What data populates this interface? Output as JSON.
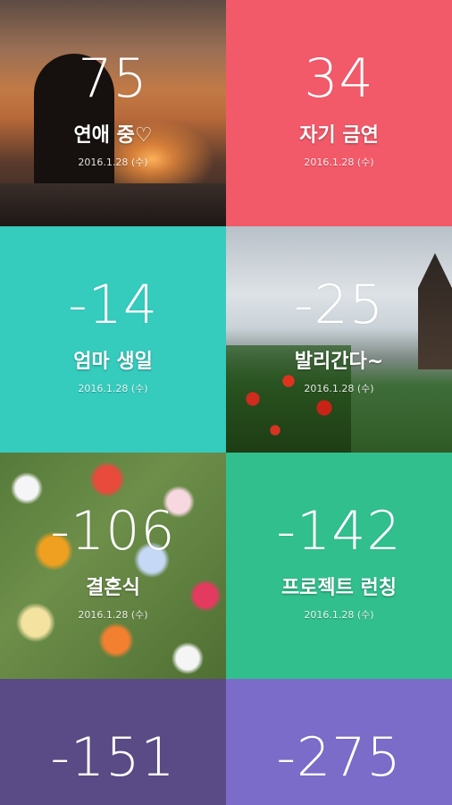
{
  "dday_list": {
    "items": [
      {
        "count": "75",
        "title": "연애 중♡",
        "date": "2016.1.28 (수)"
      },
      {
        "count": "34",
        "title": "자기 금연",
        "date": "2016.1.28 (수)"
      },
      {
        "count": "-14",
        "title": "엄마 생일",
        "date": "2016.1.28 (수)"
      },
      {
        "count": "-25",
        "title": "발리간다~",
        "date": "2016.1.28 (수)"
      },
      {
        "count": "-106",
        "title": "결혼식",
        "date": "2016.1.28 (수)"
      },
      {
        "count": "-142",
        "title": "프로젝트 런칭",
        "date": "2016.1.28 (수)"
      },
      {
        "count": "-151"
      },
      {
        "count": "-275"
      }
    ]
  },
  "colors": {
    "pink": "#f25a6a",
    "teal": "#35cbbd",
    "green": "#31bf8d",
    "purple": "#5a4b86",
    "lavender": "#7b6cc9"
  }
}
